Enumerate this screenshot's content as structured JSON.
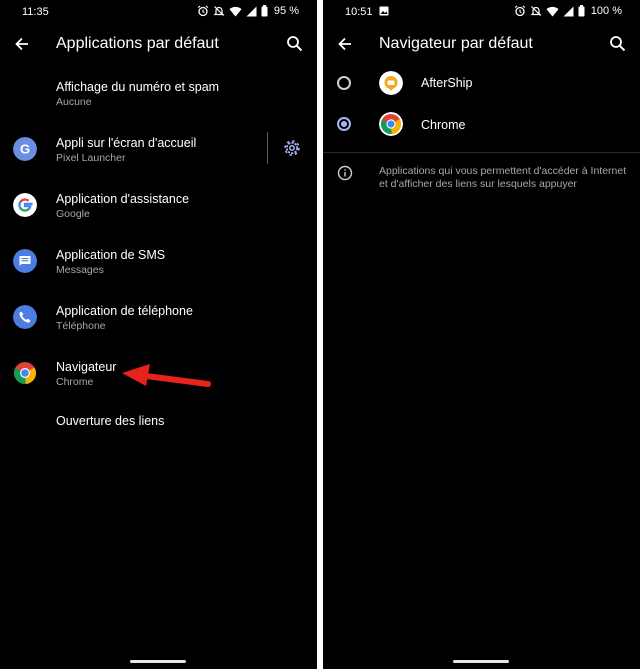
{
  "left_screen": {
    "status": {
      "time": "11:35",
      "battery": "95 %"
    },
    "toolbar": {
      "title": "Applications par défaut"
    },
    "items": [
      {
        "title": "Affichage du numéro et spam",
        "subtitle": "Aucune"
      },
      {
        "title": "Appli sur l'écran d'accueil",
        "subtitle": "Pixel Launcher"
      },
      {
        "title": "Application d'assistance",
        "subtitle": "Google"
      },
      {
        "title": "Application de SMS",
        "subtitle": "Messages"
      },
      {
        "title": "Application de téléphone",
        "subtitle": "Téléphone"
      },
      {
        "title": "Navigateur",
        "subtitle": "Chrome"
      },
      {
        "title": "Ouverture des liens"
      }
    ]
  },
  "right_screen": {
    "status": {
      "time": "10:51",
      "battery": "100 %"
    },
    "toolbar": {
      "title": "Navigateur par défaut"
    },
    "options": [
      {
        "label": "AfterShip",
        "selected": false
      },
      {
        "label": "Chrome",
        "selected": true
      }
    ],
    "info": "Applications qui vous permettent d'accéder à Internet et d'afficher des liens sur lesquels appuyer"
  },
  "colors": {
    "background": "#000000",
    "accent": "#a6b5f0",
    "secondary_text": "#a8a8a8",
    "annotation_arrow": "#e8231b"
  },
  "icons": {
    "status": [
      "alarm-icon",
      "notifications-off-icon",
      "wifi-icon",
      "signal-icon",
      "battery-icon"
    ],
    "toolbar": [
      "back-arrow-icon",
      "search-icon"
    ],
    "apps": [
      "google-g-icon",
      "google-icon",
      "messages-icon",
      "phone-icon",
      "chrome-icon",
      "aftership-icon"
    ]
  }
}
